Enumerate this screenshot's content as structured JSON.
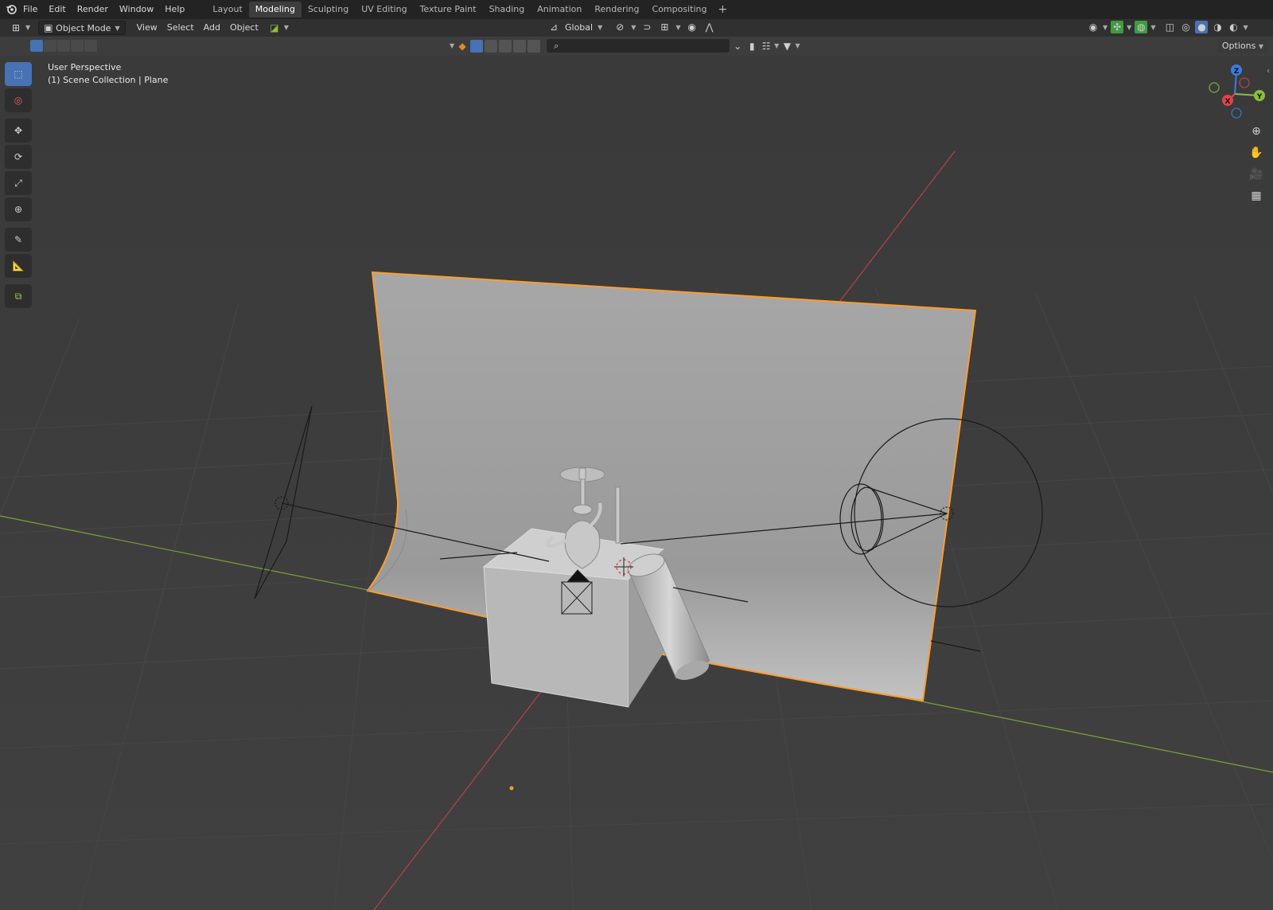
{
  "menu": [
    "File",
    "Edit",
    "Render",
    "Window",
    "Help"
  ],
  "workspaces": [
    {
      "label": "Layout",
      "active": false
    },
    {
      "label": "Modeling",
      "active": true
    },
    {
      "label": "Sculpting",
      "active": false
    },
    {
      "label": "UV Editing",
      "active": false
    },
    {
      "label": "Texture Paint",
      "active": false
    },
    {
      "label": "Shading",
      "active": false
    },
    {
      "label": "Animation",
      "active": false
    },
    {
      "label": "Rendering",
      "active": false
    },
    {
      "label": "Compositing",
      "active": false
    }
  ],
  "header": {
    "mode": "Object Mode",
    "view": "View",
    "select": "Select",
    "add": "Add",
    "object": "Object",
    "orientation": "Global"
  },
  "subheader": {
    "options": "Options",
    "search_placeholder": ""
  },
  "viewport": {
    "perspective": "User Perspective",
    "collection": "(1) Scene Collection | Plane"
  },
  "gizmo": {
    "x_label": "X",
    "y_label": "Y",
    "z_label": "Z"
  },
  "colors": {
    "accent": "#4772b3",
    "selection_outline": "#ff9c2a",
    "axis_x": "#e0444a",
    "axis_y": "#8bc03a",
    "axis_z": "#3b7be2"
  }
}
